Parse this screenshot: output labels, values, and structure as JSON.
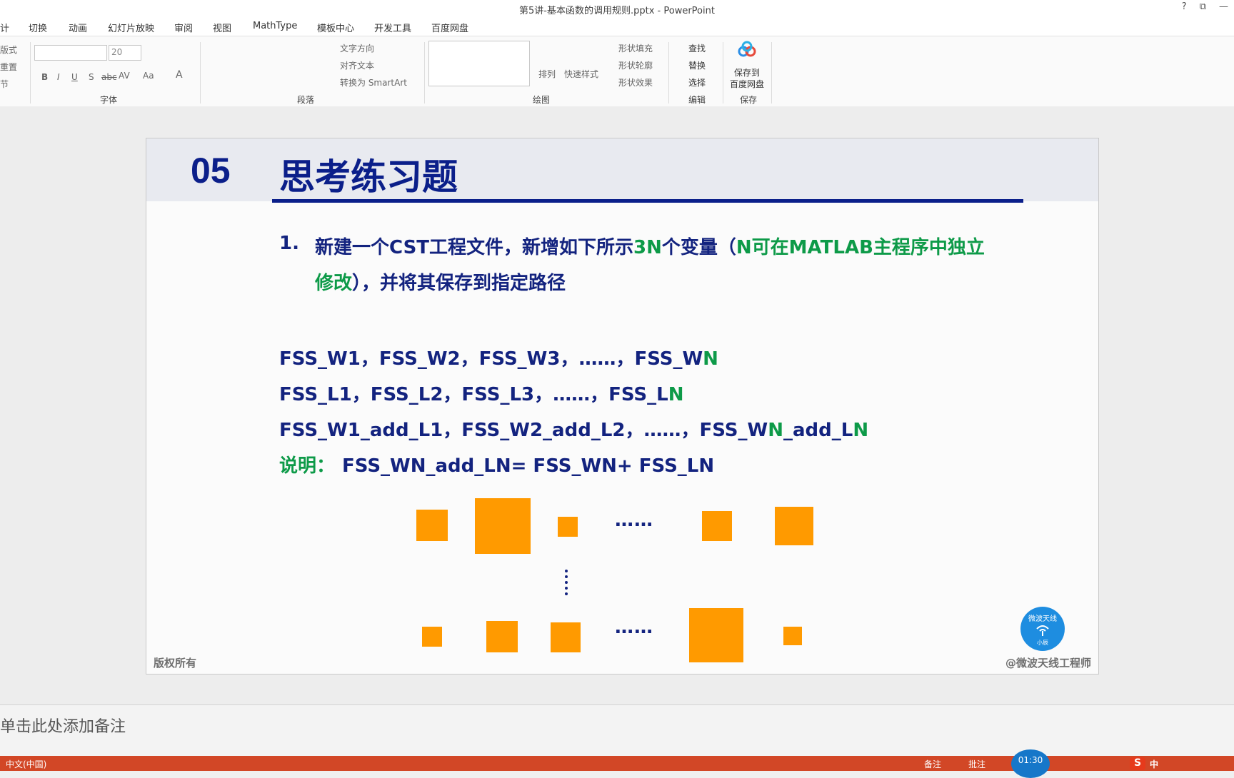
{
  "window": {
    "title": "第5讲-基本函数的调用规则.pptx - PowerPoint",
    "help": "?",
    "restore": "⧉",
    "minimize": "—"
  },
  "menu": [
    "计",
    "切换",
    "动画",
    "幻灯片放映",
    "审阅",
    "视图",
    "MathType",
    "模板中心",
    "开发工具",
    "百度网盘"
  ],
  "ribbon": {
    "left_labels": [
      "版式",
      "重置",
      "节"
    ],
    "font_size": "20",
    "font_group": "字体",
    "font_btns": [
      "B",
      "I",
      "U",
      "S",
      "abc",
      "AV",
      "Aa",
      "A"
    ],
    "paragraph_group": "段落",
    "text_direction": "文字方向",
    "align_text": "对齐文本",
    "convert_smartart": "转换为 SmartArt",
    "drawing_group": "绘图",
    "arrange": "排列",
    "quick_styles": "快速样式",
    "shape_fill": "形状填充",
    "shape_outline": "形状轮廓",
    "shape_effects": "形状效果",
    "edit_group": "编辑",
    "find": "查找",
    "replace": "替换",
    "select": "选择",
    "save_group": "保存",
    "save_to_baidu": "保存到",
    "save_to_baidu2": "百度网盘"
  },
  "slide": {
    "section_number": "05",
    "section_title": "思考练习题",
    "q1_num": "1.",
    "q1_a": "新建一个CST工程文件，新增如下所示",
    "q1_b": "3N",
    "q1_c": "个变量（",
    "q1_d": "N可在MATLAB主程序中独立",
    "q1_e": "修改",
    "q1_f": "），并将其保存到指定路径",
    "row1_a": "FSS_W1，FSS_W2，FSS_W3，……，FSS_W",
    "row1_n": "N",
    "row2_a": "FSS_L1，FSS_L2，FSS_L3，……，FSS_L",
    "row2_n": "N",
    "row3_a": "FSS_W1_add_L1，FSS_W2_add_L2，……，FSS_W",
    "row3_n1": "N",
    "row3_b": "_add_L",
    "row3_n2": "N",
    "note_label": "说明：",
    "note_text": "FSS_WN_add_LN= FSS_WN+ FSS_LN",
    "ellipsis": "……",
    "footer_left": "版权所有",
    "footer_right": "@微波天线工程师",
    "logo_top": "微波天线",
    "logo_bottom": "小辰"
  },
  "notes_placeholder": "单击此处添加备注",
  "status": {
    "language": "中文(中国)",
    "notes": "备注",
    "comments": "批注",
    "time": "01:30",
    "ime": "S",
    "ime_text": "中"
  },
  "colors": {
    "navy": "#13237f",
    "green": "#0d9a48",
    "orange": "#ff9a00",
    "status_bar": "#d24726"
  }
}
